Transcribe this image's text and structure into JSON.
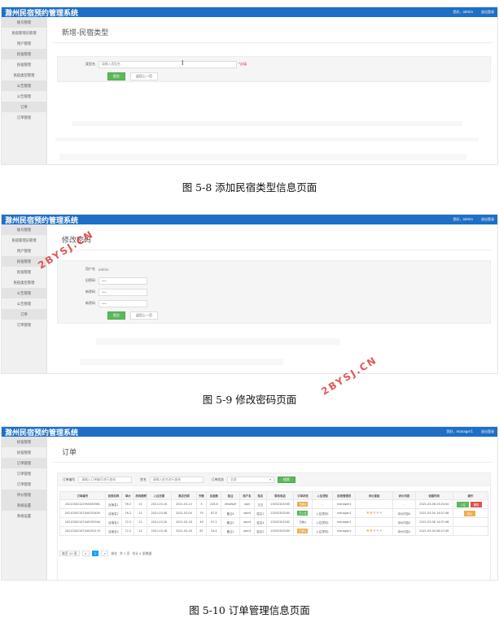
{
  "app_title": "滁州民宿预约管理系统",
  "watermark": "2BYSJ.CN",
  "figures": [
    {
      "caption": "图 5-8 添加民宿类型信息页面",
      "topbar_right": [
        "您好，admin",
        "退出登录"
      ],
      "sidebar": [
        "账号管理",
        "民宿管理员管理",
        "用户管理",
        "民宿管理",
        "民宿管理",
        "民宿类型管理",
        "公告管理",
        "公告管理",
        "订单",
        "订单管理"
      ],
      "page_title": "新增-民宿类型",
      "field_label": "类型名",
      "field_placeholder": "请输入类型名",
      "required_mark": "*必填",
      "submit_label": "提交",
      "back_label": "返回上一页"
    },
    {
      "caption": "图 5-9 修改密码页面",
      "topbar_right": [
        "您好，admin",
        "退出登录"
      ],
      "sidebar": [
        "账号管理",
        "民宿管理员管理",
        "用户管理",
        "民宿管理",
        "民宿管理",
        "民宿类型管理",
        "公告管理",
        "公告管理",
        "订单",
        "订单管理"
      ],
      "page_title": "修改密码",
      "fields": [
        {
          "label": "用户名",
          "value": "admin",
          "static": true
        },
        {
          "label": "旧密码",
          "value": "***"
        },
        {
          "label": "新密码",
          "value": "***"
        },
        {
          "label": "新密码",
          "value": "***"
        }
      ],
      "submit_label": "提交",
      "back_label": "返回上一页"
    },
    {
      "caption": "图 5-10 订单管理信息页面",
      "topbar_right": [
        "您好，manager1",
        "退出登录"
      ],
      "sidebar": [
        "民宿管理",
        "民宿管理",
        "订单管理",
        "订单管理",
        "订单管理",
        "评价管理",
        "系统设置",
        "系统设置"
      ],
      "page_title": "订单",
      "filters": {
        "order_no_label": "订单编号",
        "order_no_placeholder": "请输入订单编号进行查询",
        "name_label": "姓名",
        "name_placeholder": "请输入姓名进行查询",
        "status_label": "订单状态",
        "status_value": "全部",
        "search_label": "搜索"
      },
      "columns": [
        "订单编号",
        "民宿名称",
        "单价",
        "房间面积",
        "入住日期",
        "离店日期",
        "天数",
        "总金额",
        "备注",
        "用户名",
        "姓名",
        "联系电话",
        "订单状态",
        "入住须知",
        "民宿管理员",
        "评价星级",
        "评价内容",
        "创建时间",
        "操作"
      ],
      "rows": [
        {
          "c": [
            "20210302122950340981",
            "民宿名1",
            "76.2",
            "21",
            "2021-03-10",
            "2021-03-13",
            "3",
            "228.6",
            "dfsdfsdf",
            "user",
            "王五",
            "13552323265"
          ],
          "status": "已确认",
          "status_color": "yellow",
          "notice": "-",
          "manager": "manager1",
          "stars": 0,
          "review": "-",
          "created": "2021-03-08 23:20:04",
          "actions": [
            "入住",
            "删除"
          ]
        },
        {
          "c": [
            "20210302107440153455",
            "民宿名2",
            "76.2",
            "21",
            "2021-03-08",
            "2021-03-04",
            "79",
            "87.8",
            "备注4",
            "user4",
            "姓名1",
            "13552323265"
          ],
          "status": "已入住",
          "status_color": "green",
          "notice": "入住须知1",
          "manager": "manager1",
          "stars": 2,
          "review": "评价内容4",
          "created": "2021-03-04 14:07:46",
          "actions": [
            "评价"
          ]
        },
        {
          "c": [
            "20210302107440155944",
            "民宿名3",
            "72.2",
            "21",
            "2021-03-20",
            "2021-03-18",
            "49",
            "97.2",
            "备注2",
            "user4",
            "姓名4",
            "13552323162"
          ],
          "status": "已确认",
          "status_color": "",
          "notice": "入住须知1",
          "manager": "manager1",
          "stars": 0,
          "review": "评价内容2",
          "created": "2021-03-08 14:07:46",
          "actions": []
        },
        {
          "c": [
            "20210302107440155170",
            "民宿名4",
            "72.2",
            "21",
            "2021-03-18",
            "2021-03-16",
            "87",
            "24.4",
            "备注1",
            "user3",
            "姓名2",
            "13552323265"
          ],
          "status": "已确认",
          "status_color": "yellow",
          "notice": "入住须知1",
          "manager": "manager1",
          "stars": 2,
          "review": "评价内容1",
          "created": "2021-03-04 08:27:49",
          "actions": []
        }
      ],
      "pager": {
        "prev_label": "<",
        "page": "1",
        "next_label": ">",
        "goto_label": "前往",
        "page_unit": "共 1 页",
        "per_page": "每页 10 条",
        "total": "合计 4 条数据"
      }
    }
  ]
}
